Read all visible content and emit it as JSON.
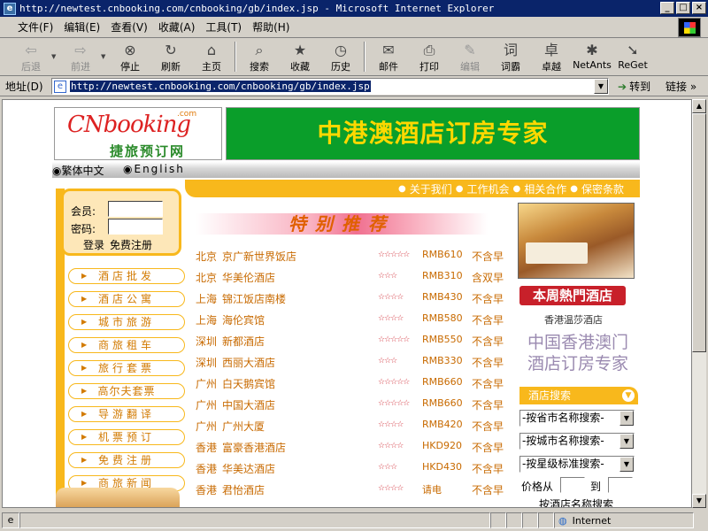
{
  "window": {
    "title": "http://newtest.cnbooking.com/cnbooking/gb/index.jsp - Microsoft Internet Explorer",
    "buttons": [
      "_",
      "□",
      "×"
    ]
  },
  "menubar": [
    "文件(F)",
    "编辑(E)",
    "查看(V)",
    "收藏(A)",
    "工具(T)",
    "帮助(H)"
  ],
  "toolbar": [
    {
      "label": "后退",
      "icon": "back-arrow-icon",
      "disabled": true
    },
    {
      "label": "前进",
      "icon": "forward-arrow-icon",
      "disabled": true
    },
    {
      "label": "停止",
      "icon": "stop-icon",
      "disabled": false
    },
    {
      "label": "刷新",
      "icon": "refresh-icon",
      "disabled": false
    },
    {
      "label": "主页",
      "icon": "home-icon",
      "disabled": false
    },
    {
      "label": "搜索",
      "icon": "search-icon",
      "disabled": false
    },
    {
      "label": "收藏",
      "icon": "favorites-icon",
      "disabled": false
    },
    {
      "label": "历史",
      "icon": "history-icon",
      "disabled": false
    },
    {
      "label": "邮件",
      "icon": "mail-icon",
      "disabled": false
    },
    {
      "label": "打印",
      "icon": "print-icon",
      "disabled": false
    },
    {
      "label": "编辑",
      "icon": "edit-icon",
      "disabled": true
    },
    {
      "label": "词霸",
      "icon": "ciba-icon",
      "disabled": false
    },
    {
      "label": "卓越",
      "icon": "joyo-icon",
      "disabled": false
    },
    {
      "label": "NetAnts",
      "icon": "netants-icon",
      "disabled": false
    },
    {
      "label": "ReGet",
      "icon": "reget-icon",
      "disabled": false
    }
  ],
  "address": {
    "label": "地址(D)",
    "url": "http://newtest.cnbooking.com/cnbooking/gb/index.jsp",
    "go_label": "转到",
    "links_label": "链接"
  },
  "page": {
    "logo": {
      "brand": "CNbooking",
      "com": ".com",
      "cn": "捷旅预订网"
    },
    "banner": "中港澳酒店订房专家",
    "languages": [
      "繁体中文",
      "English"
    ],
    "topnav": [
      "关于我们",
      "工作机会",
      "相关合作",
      "保密条款"
    ],
    "login": {
      "member_label": "会员:",
      "password_label": "密码:",
      "login_link": "登录",
      "register_link": "免费注册"
    },
    "left_menu": [
      "酒店批发",
      "酒店公寓",
      "城市旅游",
      "商旅租车",
      "旅行套票",
      "高尔夫套票",
      "导游翻译",
      "机票预订",
      "免费注册",
      "商旅新闻"
    ],
    "special_title": "特别推荐",
    "hotels": [
      {
        "city": "北京",
        "name": "京广新世界饭店",
        "stars": "☆☆☆☆☆",
        "price": "RMB610",
        "meal": "不含早"
      },
      {
        "city": "北京",
        "name": "华美伦酒店",
        "stars": "☆☆☆",
        "price": "RMB310",
        "meal": "含双早"
      },
      {
        "city": "上海",
        "name": "锦江饭店南楼",
        "stars": "☆☆☆☆",
        "price": "RMB430",
        "meal": "不含早"
      },
      {
        "city": "上海",
        "name": "海伦宾馆",
        "stars": "☆☆☆☆",
        "price": "RMB580",
        "meal": "不含早"
      },
      {
        "city": "深圳",
        "name": "新都酒店",
        "stars": "☆☆☆☆☆",
        "price": "RMB550",
        "meal": "不含早"
      },
      {
        "city": "深圳",
        "name": "西丽大酒店",
        "stars": "☆☆☆",
        "price": "RMB330",
        "meal": "不含早"
      },
      {
        "city": "广州",
        "name": "白天鹅宾馆",
        "stars": "☆☆☆☆☆",
        "price": "RMB660",
        "meal": "不含早"
      },
      {
        "city": "广州",
        "name": "中国大酒店",
        "stars": "☆☆☆☆☆",
        "price": "RMB660",
        "meal": "不含早"
      },
      {
        "city": "广州",
        "name": "广州大厦",
        "stars": "☆☆☆☆",
        "price": "RMB420",
        "meal": "不含早"
      },
      {
        "city": "香港",
        "name": "富豪香港酒店",
        "stars": "☆☆☆☆",
        "price": "HKD920",
        "meal": "不含早"
      },
      {
        "city": "香港",
        "name": "华美达酒店",
        "stars": "☆☆☆",
        "price": "HKD430",
        "meal": "不含早"
      },
      {
        "city": "香港",
        "name": "君怡酒店",
        "stars": "☆☆☆☆",
        "price": "请电",
        "meal": "不含早"
      }
    ],
    "hot_week": "本周熱門酒店",
    "hot_hotel_name": "香港温莎酒店",
    "slogan_line1": "中国香港澳门",
    "slogan_line2": "酒店订房专家",
    "search": {
      "title": "酒店搜索",
      "province": "-按省市名称搜索-",
      "city": "-按城市名称搜索-",
      "star": "-按星级标准搜索-",
      "price_from": "价格从",
      "price_to": "到",
      "by_name": "按酒店名称搜索"
    }
  },
  "status": {
    "zone": "Internet"
  }
}
